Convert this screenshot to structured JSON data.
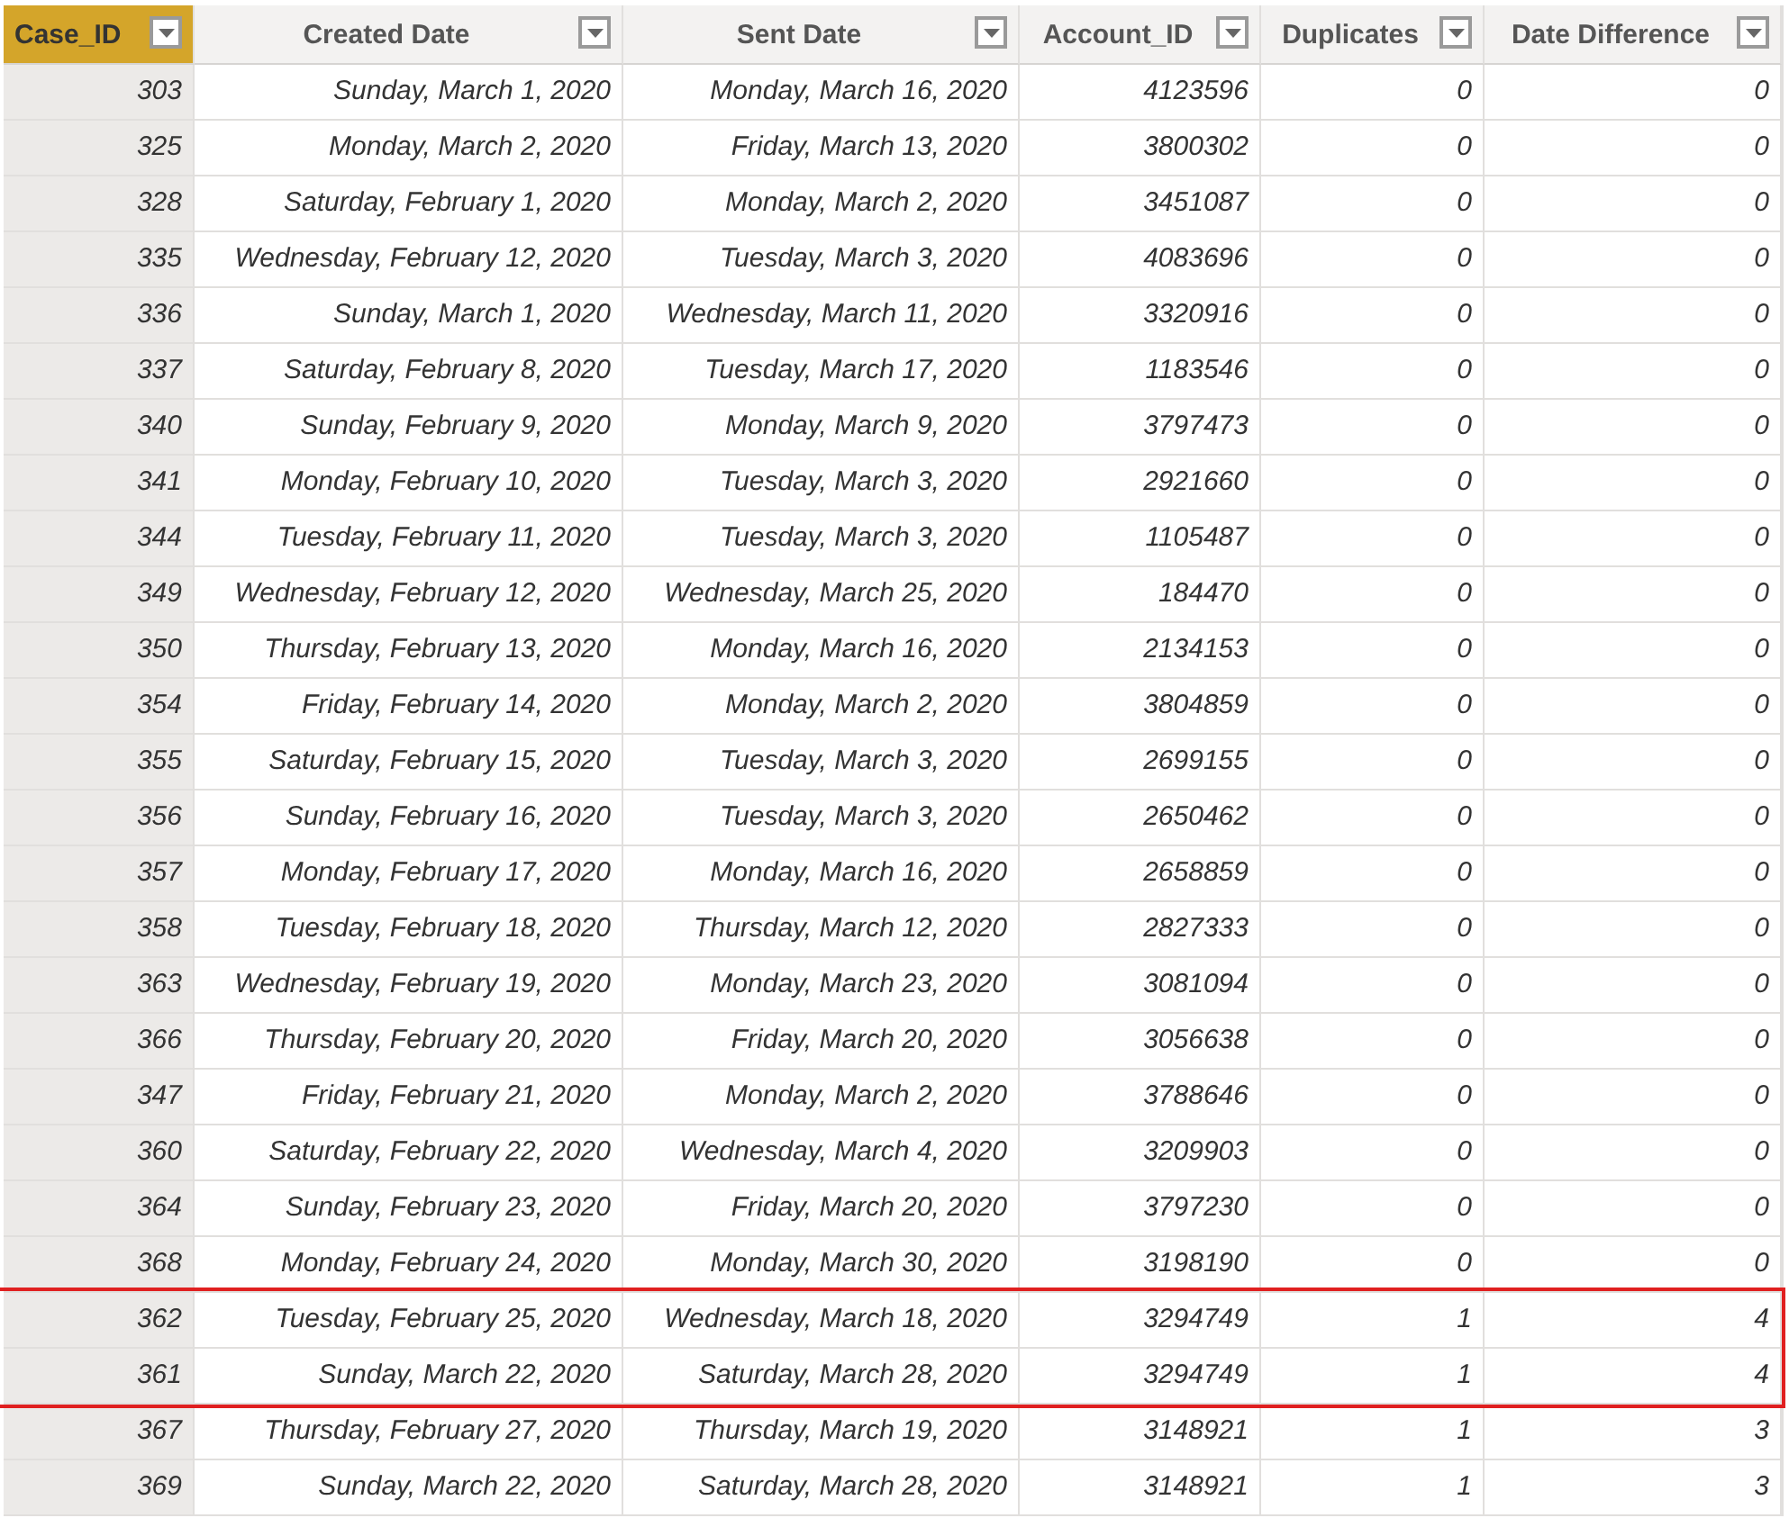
{
  "table": {
    "columns": [
      {
        "label": "Case_ID",
        "selected": true
      },
      {
        "label": "Created Date",
        "selected": false
      },
      {
        "label": "Sent Date",
        "selected": false
      },
      {
        "label": "Account_ID",
        "selected": false
      },
      {
        "label": "Duplicates",
        "selected": false
      },
      {
        "label": "Date Difference",
        "selected": false
      }
    ],
    "rows": [
      {
        "cells": [
          "303",
          "Sunday, March 1, 2020",
          "Monday, March 16, 2020",
          "4123596",
          "0",
          "0"
        ],
        "highlighted": false
      },
      {
        "cells": [
          "325",
          "Monday, March 2, 2020",
          "Friday, March 13, 2020",
          "3800302",
          "0",
          "0"
        ],
        "highlighted": false
      },
      {
        "cells": [
          "328",
          "Saturday, February 1, 2020",
          "Monday, March 2, 2020",
          "3451087",
          "0",
          "0"
        ],
        "highlighted": false
      },
      {
        "cells": [
          "335",
          "Wednesday, February 12, 2020",
          "Tuesday, March 3, 2020",
          "4083696",
          "0",
          "0"
        ],
        "highlighted": false
      },
      {
        "cells": [
          "336",
          "Sunday, March 1, 2020",
          "Wednesday, March 11, 2020",
          "3320916",
          "0",
          "0"
        ],
        "highlighted": false
      },
      {
        "cells": [
          "337",
          "Saturday, February 8, 2020",
          "Tuesday, March 17, 2020",
          "1183546",
          "0",
          "0"
        ],
        "highlighted": false
      },
      {
        "cells": [
          "340",
          "Sunday, February 9, 2020",
          "Monday, March 9, 2020",
          "3797473",
          "0",
          "0"
        ],
        "highlighted": false
      },
      {
        "cells": [
          "341",
          "Monday, February 10, 2020",
          "Tuesday, March 3, 2020",
          "2921660",
          "0",
          "0"
        ],
        "highlighted": false
      },
      {
        "cells": [
          "344",
          "Tuesday, February 11, 2020",
          "Tuesday, March 3, 2020",
          "1105487",
          "0",
          "0"
        ],
        "highlighted": false
      },
      {
        "cells": [
          "349",
          "Wednesday, February 12, 2020",
          "Wednesday, March 25, 2020",
          "184470",
          "0",
          "0"
        ],
        "highlighted": false
      },
      {
        "cells": [
          "350",
          "Thursday, February 13, 2020",
          "Monday, March 16, 2020",
          "2134153",
          "0",
          "0"
        ],
        "highlighted": false
      },
      {
        "cells": [
          "354",
          "Friday, February 14, 2020",
          "Monday, March 2, 2020",
          "3804859",
          "0",
          "0"
        ],
        "highlighted": false
      },
      {
        "cells": [
          "355",
          "Saturday, February 15, 2020",
          "Tuesday, March 3, 2020",
          "2699155",
          "0",
          "0"
        ],
        "highlighted": false
      },
      {
        "cells": [
          "356",
          "Sunday, February 16, 2020",
          "Tuesday, March 3, 2020",
          "2650462",
          "0",
          "0"
        ],
        "highlighted": false
      },
      {
        "cells": [
          "357",
          "Monday, February 17, 2020",
          "Monday, March 16, 2020",
          "2658859",
          "0",
          "0"
        ],
        "highlighted": false
      },
      {
        "cells": [
          "358",
          "Tuesday, February 18, 2020",
          "Thursday, March 12, 2020",
          "2827333",
          "0",
          "0"
        ],
        "highlighted": false
      },
      {
        "cells": [
          "363",
          "Wednesday, February 19, 2020",
          "Monday, March 23, 2020",
          "3081094",
          "0",
          "0"
        ],
        "highlighted": false
      },
      {
        "cells": [
          "366",
          "Thursday, February 20, 2020",
          "Friday, March 20, 2020",
          "3056638",
          "0",
          "0"
        ],
        "highlighted": false
      },
      {
        "cells": [
          "347",
          "Friday, February 21, 2020",
          "Monday, March 2, 2020",
          "3788646",
          "0",
          "0"
        ],
        "highlighted": false
      },
      {
        "cells": [
          "360",
          "Saturday, February 22, 2020",
          "Wednesday, March 4, 2020",
          "3209903",
          "0",
          "0"
        ],
        "highlighted": false
      },
      {
        "cells": [
          "364",
          "Sunday, February 23, 2020",
          "Friday, March 20, 2020",
          "3797230",
          "0",
          "0"
        ],
        "highlighted": false
      },
      {
        "cells": [
          "368",
          "Monday, February 24, 2020",
          "Monday, March 30, 2020",
          "3198190",
          "0",
          "0"
        ],
        "highlighted": false
      },
      {
        "cells": [
          "362",
          "Tuesday, February 25, 2020",
          "Wednesday, March 18, 2020",
          "3294749",
          "1",
          "4"
        ],
        "highlighted": true
      },
      {
        "cells": [
          "361",
          "Sunday, March 22, 2020",
          "Saturday, March 28, 2020",
          "3294749",
          "1",
          "4"
        ],
        "highlighted": true
      },
      {
        "cells": [
          "367",
          "Thursday, February 27, 2020",
          "Thursday, March 19, 2020",
          "3148921",
          "1",
          "3"
        ],
        "highlighted": false
      },
      {
        "cells": [
          "369",
          "Sunday, March 22, 2020",
          "Saturday, March 28, 2020",
          "3148921",
          "1",
          "3"
        ],
        "highlighted": false
      }
    ]
  }
}
